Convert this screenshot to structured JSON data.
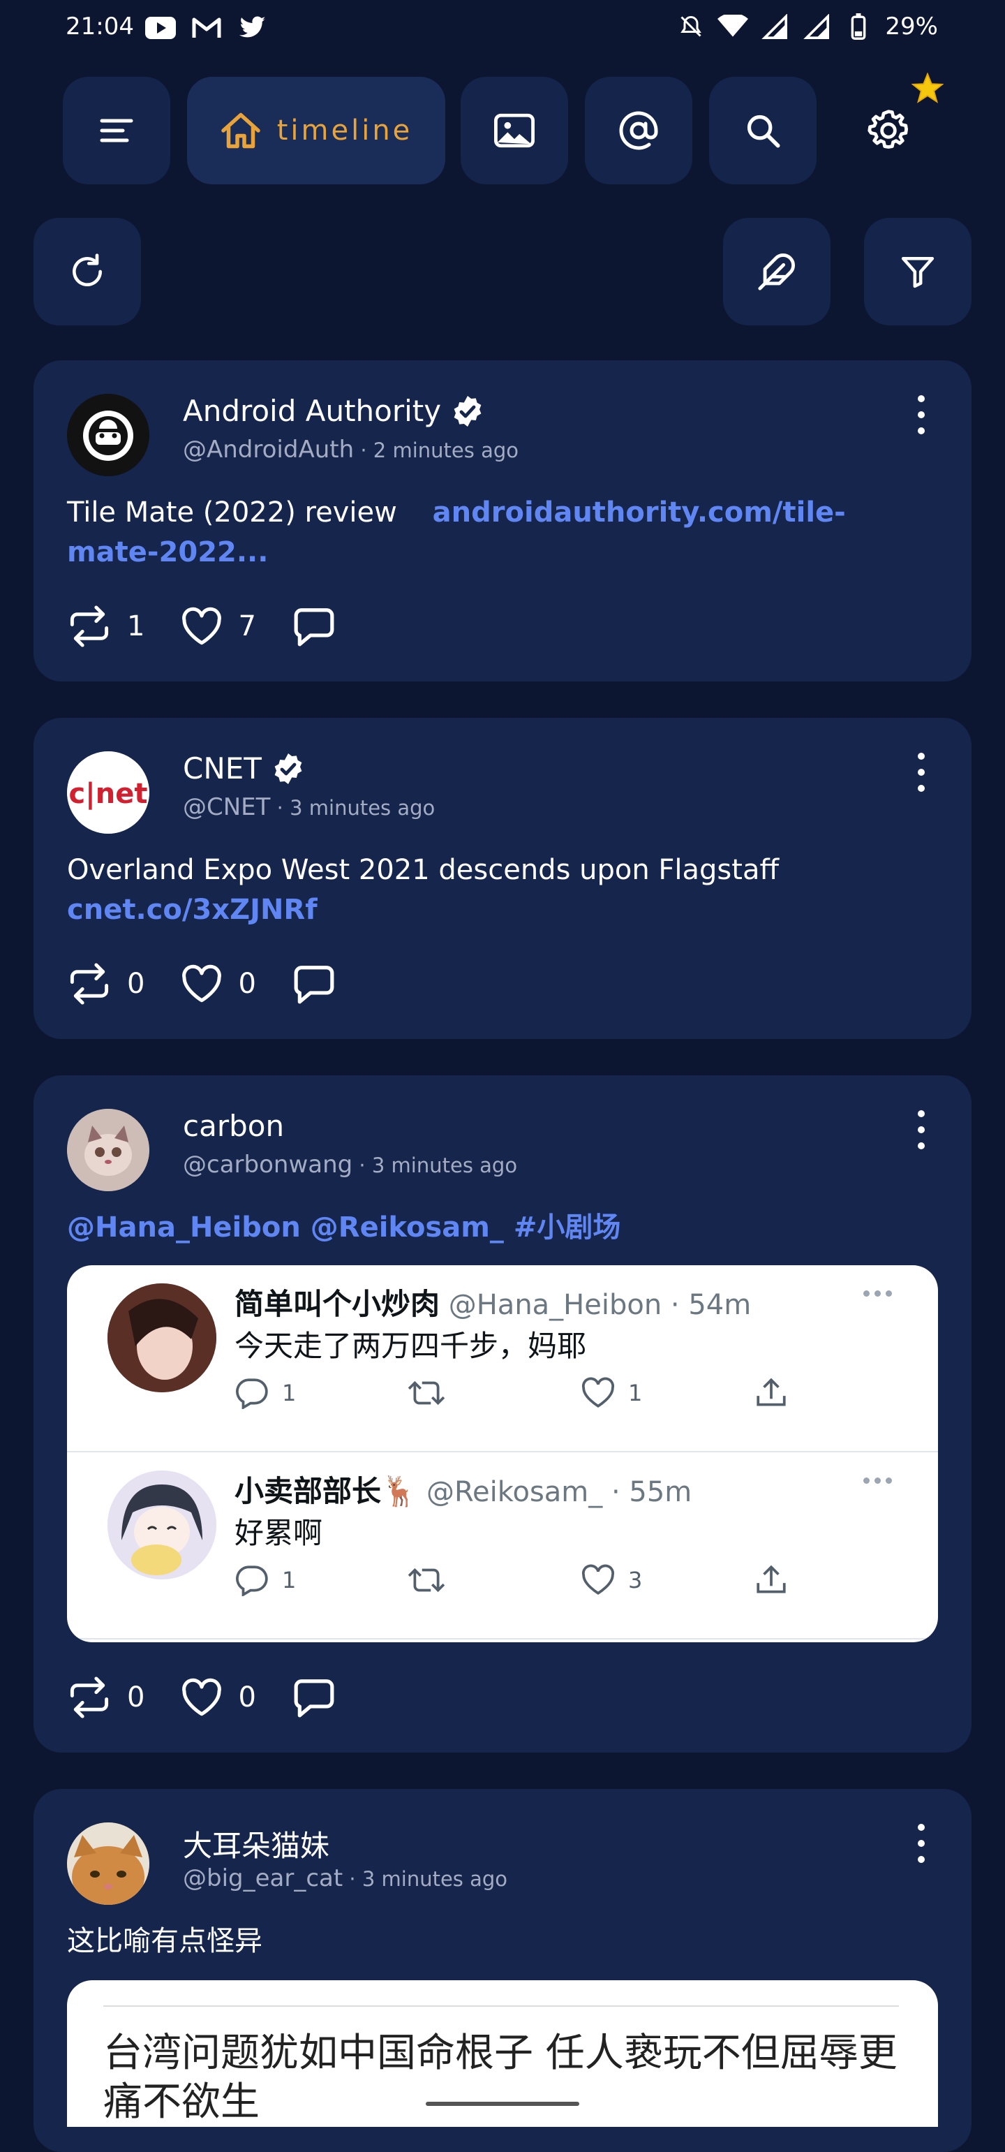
{
  "status_bar": {
    "time": "21:04",
    "battery": "29%"
  },
  "nav": {
    "timeline_label": "timeline"
  },
  "posts": [
    {
      "name": "Android Authority",
      "handle": "@AndroidAuth",
      "ago": " · 2 minutes ago",
      "text": "Tile Mate (2022) review ",
      "link": "androidauthority.com/tile-mate-2022...",
      "retweets": "1",
      "likes": "7"
    },
    {
      "name": "CNET",
      "handle": "@CNET",
      "ago": " · 3 minutes ago",
      "text": "Overland Expo West 2021 descends upon Flagstaff ",
      "link": "cnet.co/3xZJNRf",
      "retweets": "0",
      "likes": "0"
    },
    {
      "name": "carbon",
      "handle": "@carbonwang",
      "ago": " · 3 minutes ago",
      "mentions": "@Hana_Heibon @Reikosam_ #小剧场",
      "retweets": "0",
      "likes": "0",
      "embedded": [
        {
          "name": "简单叫个小炒肉",
          "handle": " @Hana_Heibon · 54m",
          "text": "今天走了两万四千步，妈耶",
          "replies": "1",
          "likes": "1"
        },
        {
          "name": "小卖部部长🦌",
          "handle": " @Reikosam_ · 55m",
          "text": "好累啊",
          "replies": "1",
          "likes": "3"
        }
      ]
    },
    {
      "name": "大耳朵猫妹",
      "handle": "@big_ear_cat",
      "ago": " · 3 minutes ago",
      "text": "这比喻有点怪异",
      "article_text": "台湾问题犹如中国命根子 任人亵玩不但屈辱更痛不欲生"
    }
  ]
}
